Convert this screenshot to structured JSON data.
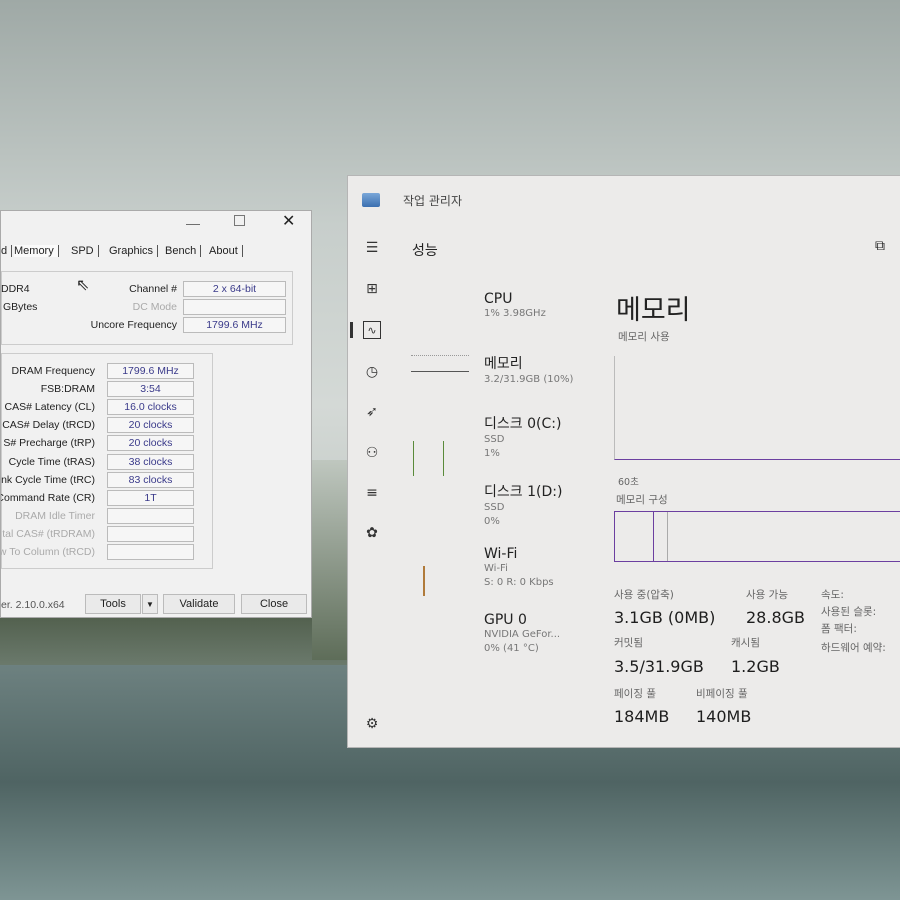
{
  "cpuz": {
    "tabs": [
      "d",
      "Memory",
      "SPD",
      "Graphics",
      "Bench",
      "About"
    ],
    "active_tab": "Memory",
    "type": "DDR4",
    "size_unit": "GBytes",
    "channel_label": "Channel #",
    "channel_value": "2 x 64-bit",
    "dc_mode_label": "DC Mode",
    "dc_mode_value": "",
    "uncore_label": "Uncore Frequency",
    "uncore_value": "1799.6 MHz",
    "timings": [
      {
        "label": "DRAM Frequency",
        "value": "1799.6 MHz"
      },
      {
        "label": "FSB:DRAM",
        "value": "3:54"
      },
      {
        "label": "CAS# Latency (CL)",
        "value": "16.0 clocks"
      },
      {
        "label": "CAS# Delay (tRCD)",
        "value": "20 clocks"
      },
      {
        "label": "S# Precharge (tRP)",
        "value": "20 clocks"
      },
      {
        "label": "Cycle Time (tRAS)",
        "value": "38 clocks"
      },
      {
        "label": "nk Cycle Time (tRC)",
        "value": "83 clocks"
      },
      {
        "label": "Command Rate (CR)",
        "value": "1T"
      },
      {
        "label": "DRAM Idle Timer",
        "value": ""
      },
      {
        "label": "tal CAS# (tRDRAM)",
        "value": ""
      },
      {
        "label": "w To Column (tRCD)",
        "value": ""
      }
    ],
    "version": "er. 2.10.0.x64",
    "tools_label": "Tools",
    "validate_label": "Validate",
    "close_label": "Close"
  },
  "taskmgr": {
    "title": "작업 관리자",
    "section": "성능",
    "items": [
      {
        "name": "CPU",
        "sub1": "1% 3.98GHz",
        "sub2": ""
      },
      {
        "name": "메모리",
        "sub1": "3.2/31.9GB (10%)",
        "sub2": ""
      },
      {
        "name": "디스크 0(C:)",
        "sub1": "SSD",
        "sub2": "1%"
      },
      {
        "name": "디스크 1(D:)",
        "sub1": "SSD",
        "sub2": "0%"
      },
      {
        "name": "Wi-Fi",
        "sub1": "Wi-Fi",
        "sub2": "S: 0 R: 0 Kbps"
      },
      {
        "name": "GPU 0",
        "sub1": "NVIDIA GeFor...",
        "sub2": "0% (41 °C)"
      }
    ],
    "detail": {
      "title": "메모리",
      "usage_label": "메모리 사용",
      "time_label": "60초",
      "composition_label": "메모리 구성",
      "in_use_label": "사용 중(압축)",
      "in_use_value": "3.1GB (0MB)",
      "available_label": "사용 가능",
      "available_value": "28.8GB",
      "committed_label": "커밋됨",
      "committed_value": "3.5/31.9GB",
      "cached_label": "캐시됨",
      "cached_value": "1.2GB",
      "paged_label": "페이징 풀",
      "paged_value": "184MB",
      "nonpaged_label": "비페이징 풀",
      "nonpaged_value": "140MB",
      "speed_label": "속도:",
      "slots_label": "사용된 슬롯:",
      "form_label": "폼 팩터:",
      "reserved_label": "하드웨어 예약:"
    },
    "accent": "#6b3fa0"
  }
}
